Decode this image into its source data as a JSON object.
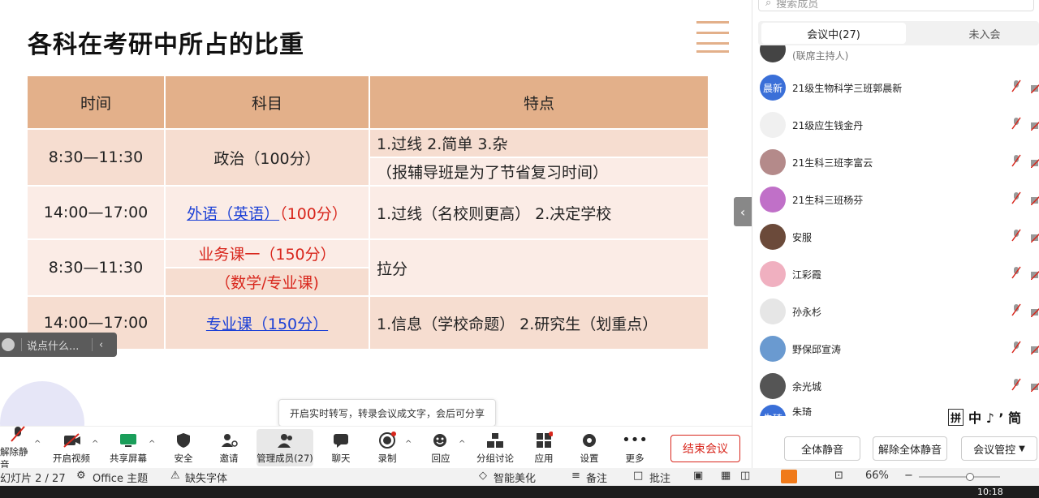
{
  "slide": {
    "title": "各科在考研中所占的比重",
    "headers": [
      "时间",
      "科目",
      "特点"
    ],
    "rows": [
      {
        "time": "8:30—11:30",
        "subject": "政治（100分）",
        "feature_lines": [
          "1.过线   2.简单   3.杂",
          "（报辅导班是为了节省复习时间）"
        ]
      },
      {
        "time": "14:00—17:00",
        "subject_link": "外语（英语）",
        "subject_extra": "（100分）",
        "feature": "1.过线（名校则更高）   2.决定学校"
      },
      {
        "time": "8:30—11:30",
        "subject_lines": [
          "业务课一（150分）",
          "（数学/专业课)"
        ],
        "feature": "拉分"
      },
      {
        "time": "14:00—17:00",
        "subject_link": "专业课（150分）",
        "feature": "1.信息（学校命题）   2.研究生（划重点）"
      }
    ]
  },
  "comment_bar": {
    "placeholder": "说点什么..."
  },
  "tooltip": "开启实时转写，转录会议成文字，会后可分享",
  "toolbar": {
    "unmute": "解除静音",
    "video": "开启视频",
    "share": "共享屏幕",
    "security": "安全",
    "invite": "邀请",
    "members": "管理成员(27)",
    "chat": "聊天",
    "record": "录制",
    "react": "回应",
    "breakout": "分组讨论",
    "apps": "应用",
    "settings": "设置",
    "more": "更多",
    "end": "结束会议"
  },
  "status": {
    "slide_counter": "幻灯片 2 / 27",
    "theme": "Office 主题",
    "missing_font": "缺失字体",
    "beautify": "智能美化",
    "notes": "备注",
    "comments": "批注",
    "zoom": "66%",
    "clock": "10:18"
  },
  "panel": {
    "search_placeholder": "搜索成员",
    "tab_in_meeting": "会议中(27)",
    "tab_not_joined": "未入会",
    "cohost_label": "(联席主持人)",
    "members": [
      {
        "name": "21级生物科学三班郭晨新",
        "avatar_text": "晨新",
        "color": "#3a6fd8"
      },
      {
        "name": "21级应生钱金丹",
        "avatar_text": "",
        "color": "#f0f0f0"
      },
      {
        "name": "21生科三班李富云",
        "avatar_text": "",
        "color": "#b48a8a"
      },
      {
        "name": "21生科三班杨芬",
        "avatar_text": "",
        "color": "#c070c8"
      },
      {
        "name": "安服",
        "avatar_text": "",
        "color": "#6b4a3a"
      },
      {
        "name": "江彩霞",
        "avatar_text": "",
        "color": "#f0b0c0"
      },
      {
        "name": "孙永杉",
        "avatar_text": "",
        "color": "#e6e6e6"
      },
      {
        "name": "野保邱宣涛",
        "avatar_text": "",
        "color": "#6a9ad0"
      },
      {
        "name": "余光城",
        "avatar_text": "",
        "color": "#555555"
      },
      {
        "name": "朱琦",
        "avatar_text": "朱琦",
        "color": "#3a6fd8"
      }
    ],
    "mute_all": "全体静音",
    "unmute_all": "解除全体静音",
    "meeting_control": "会议管控",
    "ime": "中 ♪ ʼ 简"
  },
  "colors": {
    "header": "#e3b08a",
    "row_odd": "#f6ddd0",
    "row_even": "#fbece6",
    "link": "#1a3fd6",
    "accent_red": "#d8261c"
  }
}
